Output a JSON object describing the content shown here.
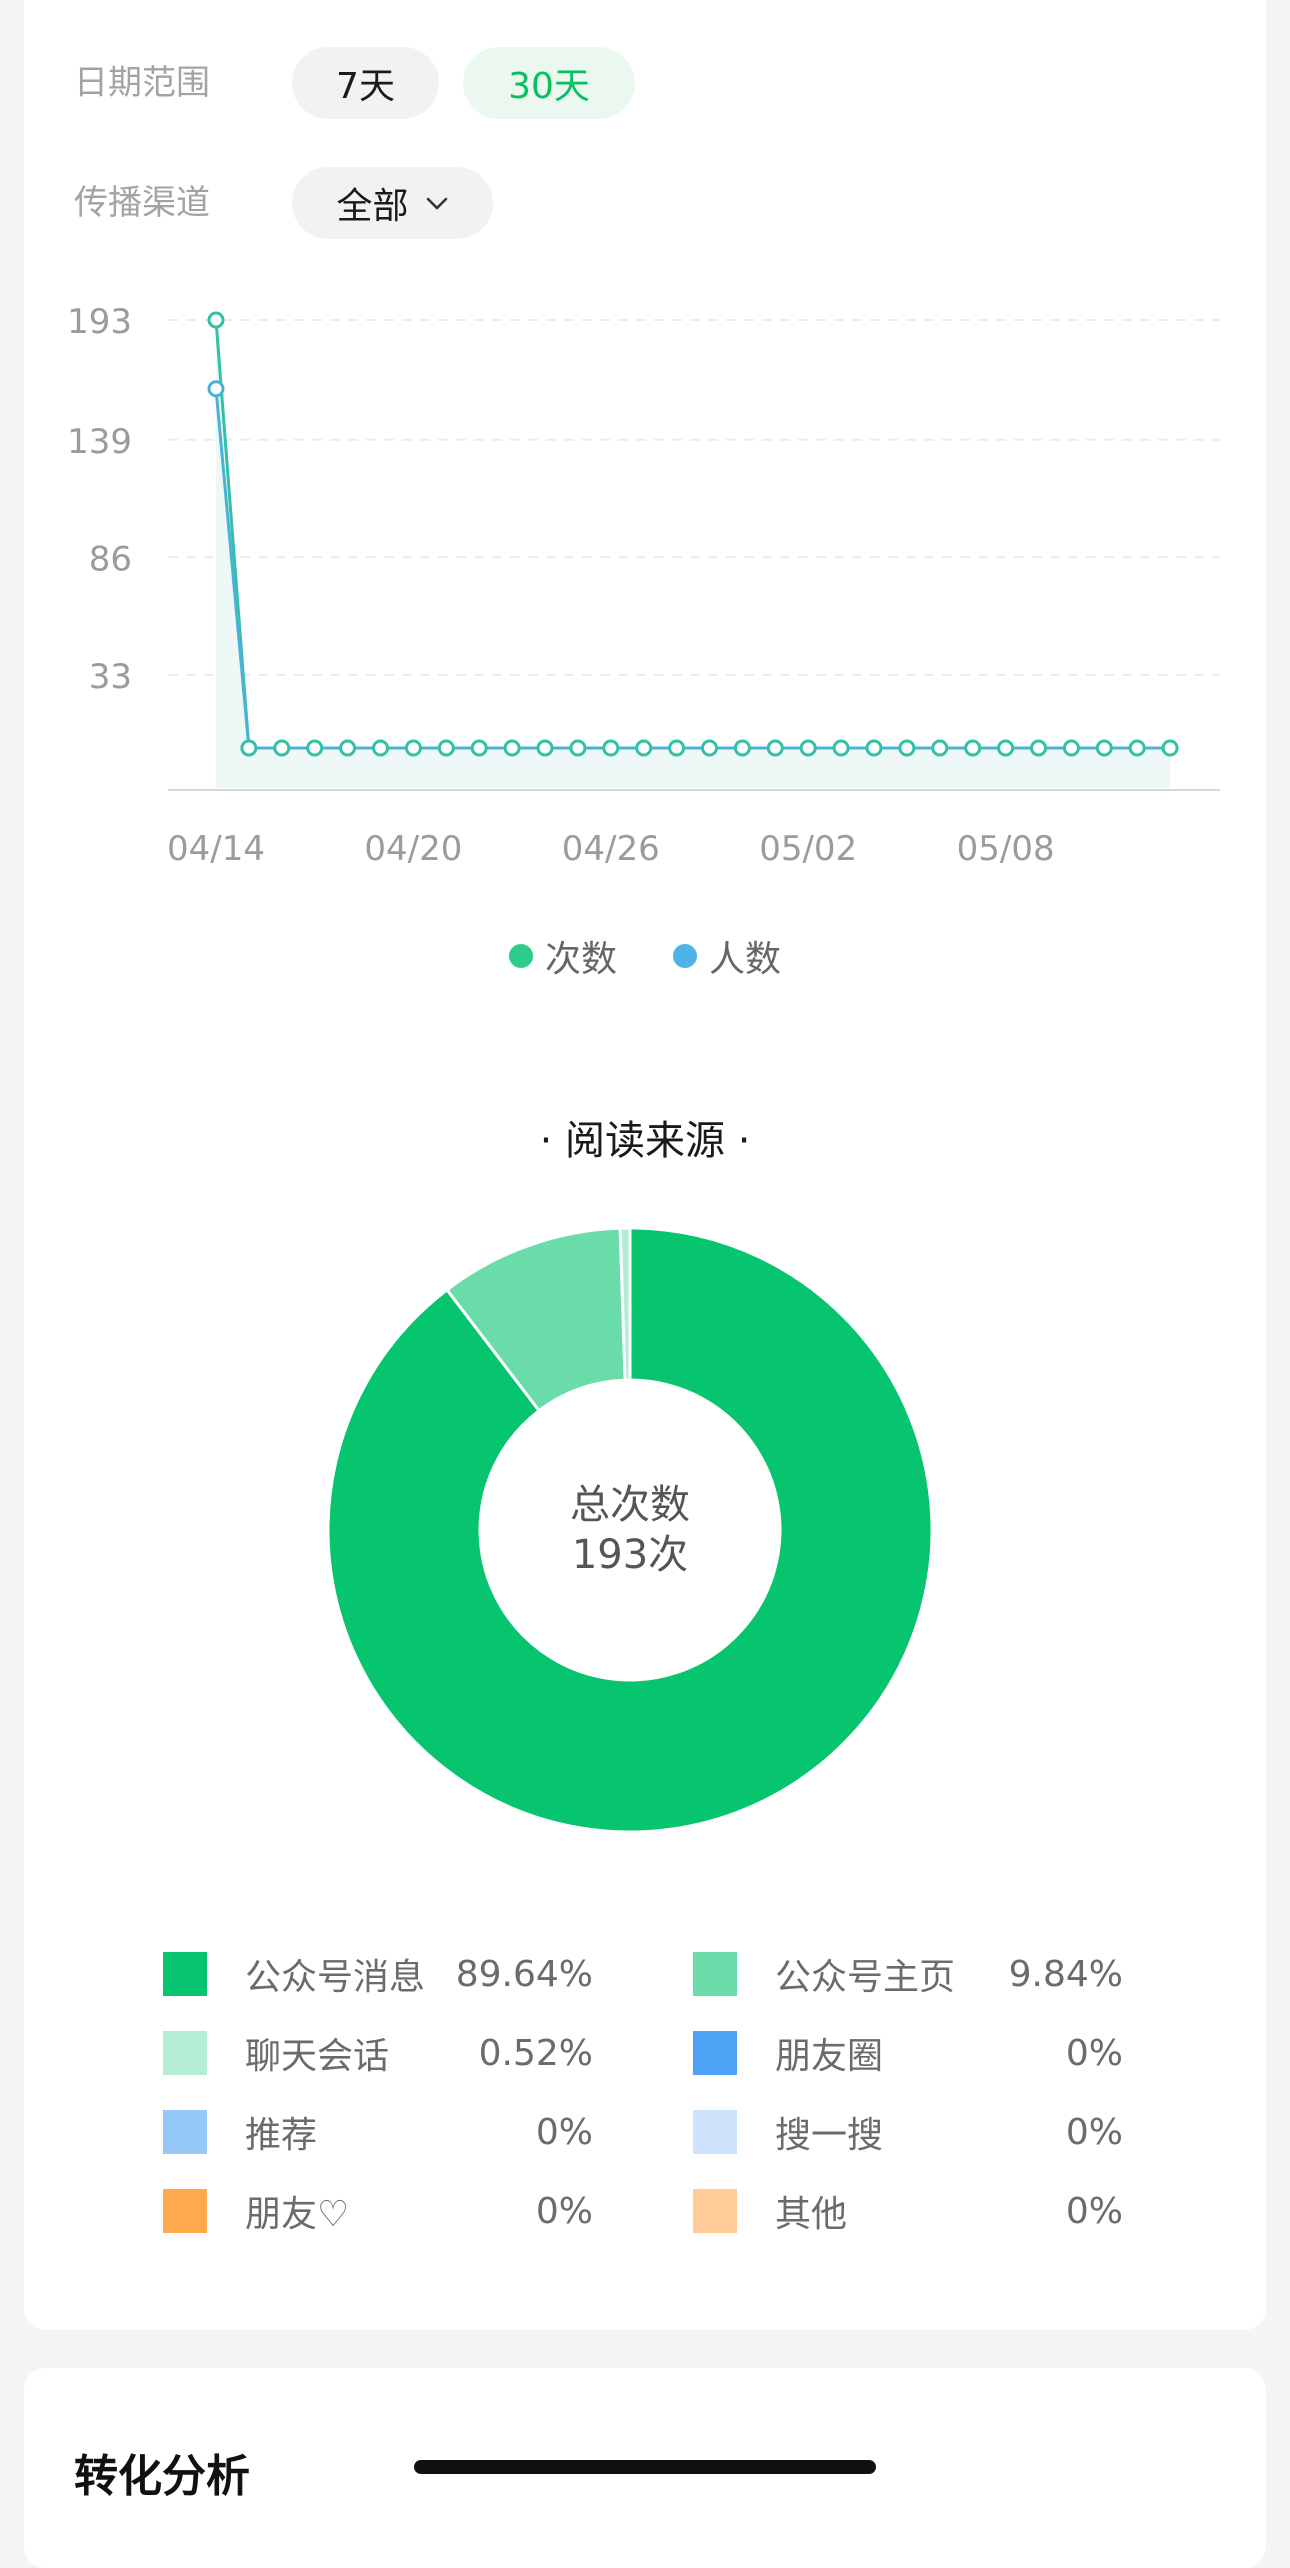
{
  "filters": {
    "date_range_label": "日期范围",
    "option_7": "7天",
    "option_30": "30天",
    "channel_label": "传播渠道",
    "channel_value": "全部",
    "chevron_icon": "chevron-down-icon"
  },
  "trend": {
    "legend": [
      {
        "name": "次数",
        "color": "#2ecc8a"
      },
      {
        "name": "人数",
        "color": "#4eb3e6"
      }
    ]
  },
  "chart_data": [
    {
      "type": "line",
      "y_ticks": [
        193,
        139,
        86,
        33
      ],
      "ylim": [
        0,
        193
      ],
      "x_tick_labels": [
        "04/14",
        "04/20",
        "04/26",
        "05/02",
        "05/08"
      ],
      "x": [
        "04/14",
        "04/15",
        "04/16",
        "04/17",
        "04/18",
        "04/19",
        "04/20",
        "04/21",
        "04/22",
        "04/23",
        "04/24",
        "04/25",
        "04/26",
        "04/27",
        "04/28",
        "04/29",
        "04/30",
        "05/01",
        "05/02",
        "05/03",
        "05/04",
        "05/05",
        "05/06",
        "05/07",
        "05/08",
        "05/09",
        "05/10",
        "05/11",
        "05/12",
        "05/13"
      ],
      "series": [
        {
          "name": "次数",
          "color": "#2ecc8a",
          "values": [
            193,
            0,
            0,
            0,
            0,
            0,
            0,
            0,
            0,
            0,
            0,
            0,
            0,
            0,
            0,
            0,
            0,
            0,
            0,
            0,
            0,
            0,
            0,
            0,
            0,
            0,
            0,
            0,
            0,
            0
          ]
        },
        {
          "name": "人数",
          "color": "#4eb3e6",
          "values": [
            162,
            0,
            0,
            0,
            0,
            0,
            0,
            0,
            0,
            0,
            0,
            0,
            0,
            0,
            0,
            0,
            0,
            0,
            0,
            0,
            0,
            0,
            0,
            0,
            0,
            0,
            0,
            0,
            0,
            0
          ]
        }
      ],
      "grid": true
    },
    {
      "type": "pie",
      "title": "阅读来源",
      "center_label": "总次数",
      "center_value": "193次",
      "slices": [
        {
          "name": "公众号消息",
          "value": 89.64,
          "label": "89.64%",
          "color": "#07c46f"
        },
        {
          "name": "公众号主页",
          "value": 9.84,
          "label": "9.84%",
          "color": "#6adcaa"
        },
        {
          "name": "聊天会话",
          "value": 0.52,
          "label": "0.52%",
          "color": "#b3eed4"
        },
        {
          "name": "朋友圈",
          "value": 0,
          "label": "0%",
          "color": "#4fa3f7"
        },
        {
          "name": "推荐",
          "value": 0,
          "label": "0%",
          "color": "#95c7f9"
        },
        {
          "name": "搜一搜",
          "value": 0,
          "label": "0%",
          "color": "#cde3fb"
        },
        {
          "name": "朋友♡",
          "value": 0,
          "label": "0%",
          "color": "#ffa94d"
        },
        {
          "name": "其他",
          "value": 0,
          "label": "0%",
          "color": "#ffcb98"
        }
      ]
    }
  ],
  "conversion": {
    "title": "转化分析"
  }
}
